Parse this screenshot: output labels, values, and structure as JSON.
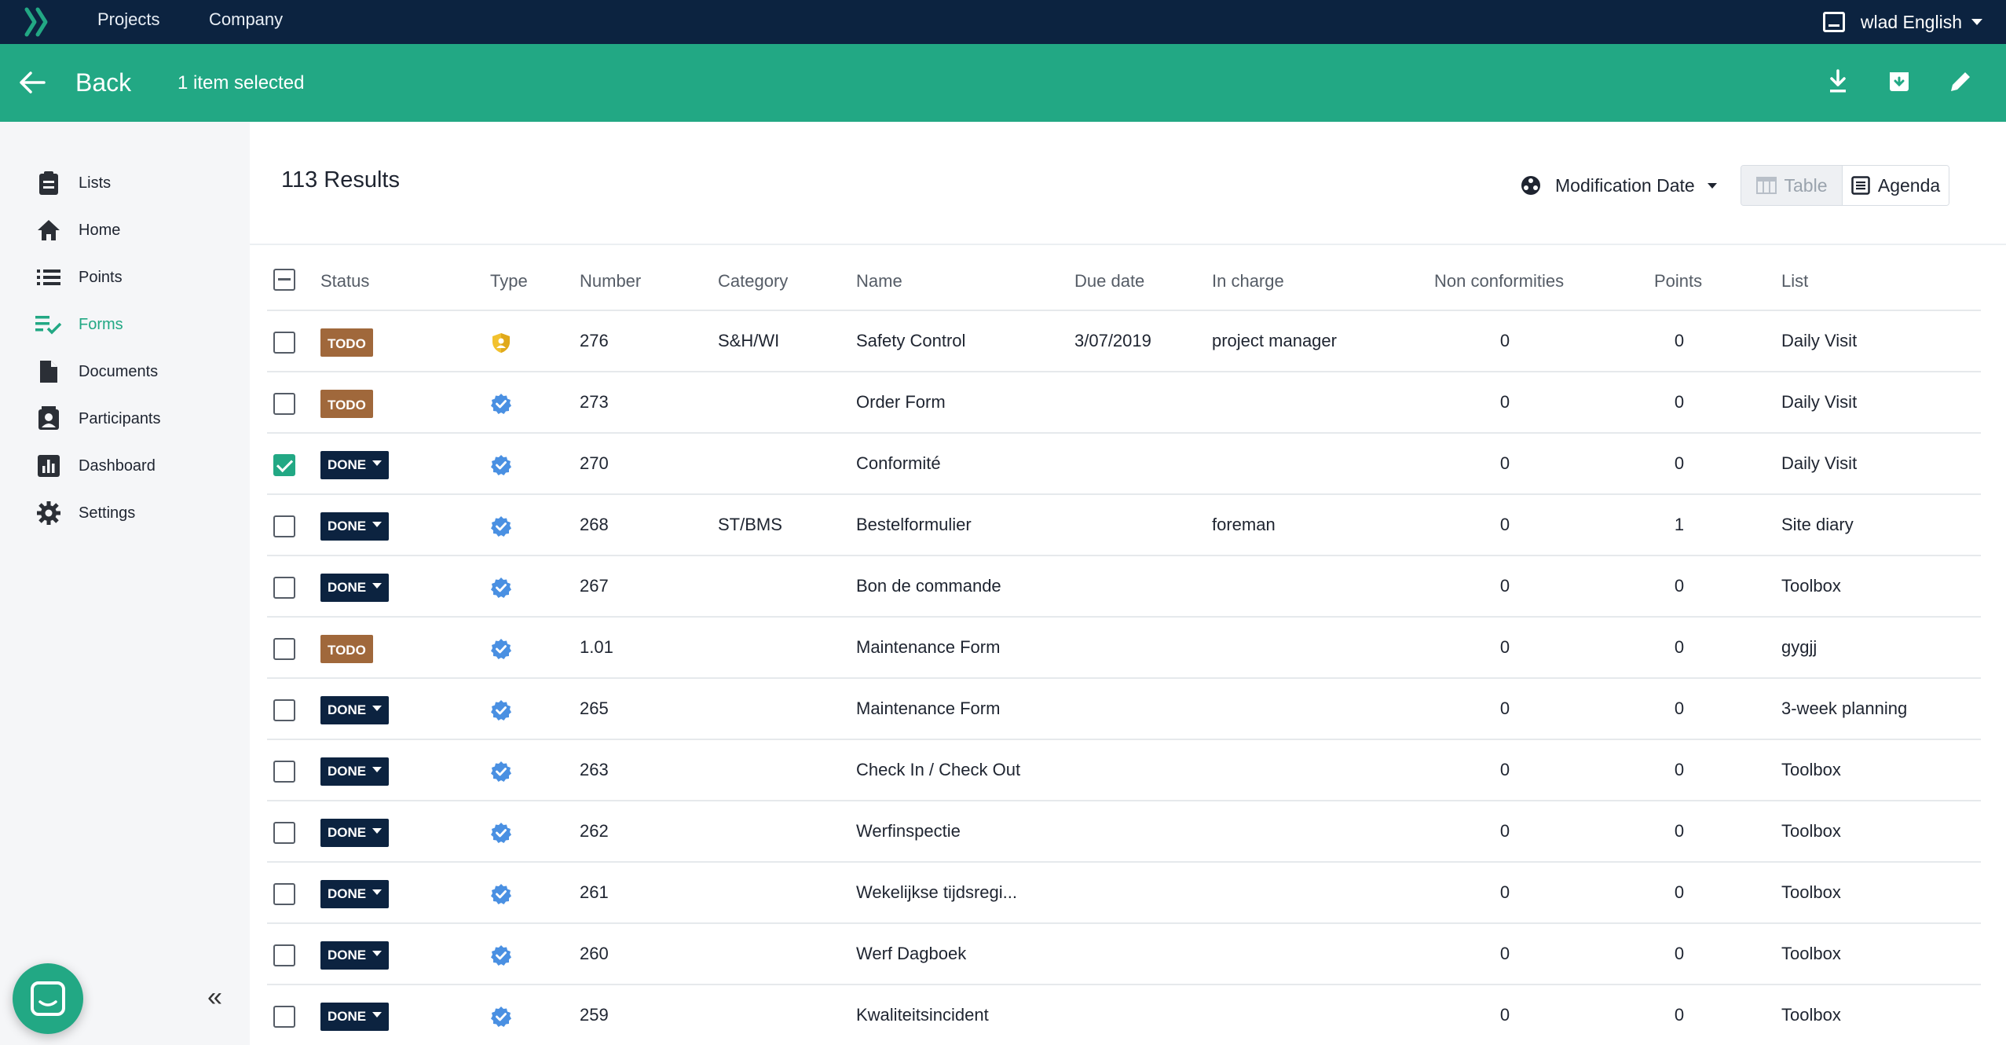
{
  "topnav": {
    "items": [
      "Projects",
      "Company"
    ],
    "user_label": "wlad English"
  },
  "actionbar": {
    "back_label": "Back",
    "selection_label": "1 item selected",
    "actions": [
      "download-icon",
      "archive-icon",
      "edit-icon"
    ]
  },
  "sidebar": {
    "items": [
      {
        "label": "Lists",
        "icon": "clipboard-icon"
      },
      {
        "label": "Home",
        "icon": "home-icon"
      },
      {
        "label": "Points",
        "icon": "list-icon"
      },
      {
        "label": "Forms",
        "icon": "checklist-icon",
        "active": true
      },
      {
        "label": "Documents",
        "icon": "document-icon"
      },
      {
        "label": "Participants",
        "icon": "participants-icon"
      },
      {
        "label": "Dashboard",
        "icon": "chart-icon"
      },
      {
        "label": "Settings",
        "icon": "gear-icon"
      }
    ],
    "collapse_label": "«"
  },
  "results": {
    "count_label": "113  Results",
    "sort_label": "Modification Date",
    "view_table": "Table",
    "view_agenda": "Agenda"
  },
  "table": {
    "columns": [
      "Status",
      "Type",
      "Number",
      "Category",
      "Name",
      "Due date",
      "In charge",
      "Non conformities",
      "Points",
      "List"
    ],
    "rows": [
      {
        "checked": false,
        "status": "TODO",
        "type": "shield",
        "number": "276",
        "category": "S&H/WI",
        "name": "Safety Control",
        "due": "3/07/2019",
        "in_charge": "project manager",
        "nc": "0",
        "points": "0",
        "list": "Daily Visit"
      },
      {
        "checked": false,
        "status": "TODO",
        "type": "verified",
        "number": "273",
        "category": "",
        "name": "Order Form",
        "due": "",
        "in_charge": "",
        "nc": "0",
        "points": "0",
        "list": "Daily Visit"
      },
      {
        "checked": true,
        "status": "DONE",
        "type": "verified",
        "number": "270",
        "category": "",
        "name": "Conformité",
        "due": "",
        "in_charge": "",
        "nc": "0",
        "points": "0",
        "list": "Daily Visit"
      },
      {
        "checked": false,
        "status": "DONE",
        "type": "verified",
        "number": "268",
        "category": "ST/BMS",
        "name": "Bestelformulier",
        "due": "",
        "in_charge": "foreman",
        "nc": "0",
        "points": "1",
        "list": "Site diary"
      },
      {
        "checked": false,
        "status": "DONE",
        "type": "verified",
        "number": "267",
        "category": "",
        "name": "Bon de commande",
        "due": "",
        "in_charge": "",
        "nc": "0",
        "points": "0",
        "list": "Toolbox"
      },
      {
        "checked": false,
        "status": "TODO",
        "type": "verified",
        "number": "1.01",
        "category": "",
        "name": "Maintenance Form",
        "due": "",
        "in_charge": "",
        "nc": "0",
        "points": "0",
        "list": "gygjj"
      },
      {
        "checked": false,
        "status": "DONE",
        "type": "verified",
        "number": "265",
        "category": "",
        "name": "Maintenance Form",
        "due": "",
        "in_charge": "",
        "nc": "0",
        "points": "0",
        "list": "3-week planning"
      },
      {
        "checked": false,
        "status": "DONE",
        "type": "verified",
        "number": "263",
        "category": "",
        "name": "Check In / Check Out",
        "due": "",
        "in_charge": "",
        "nc": "0",
        "points": "0",
        "list": "Toolbox"
      },
      {
        "checked": false,
        "status": "DONE",
        "type": "verified",
        "number": "262",
        "category": "",
        "name": "Werfinspectie",
        "due": "",
        "in_charge": "",
        "nc": "0",
        "points": "0",
        "list": "Toolbox"
      },
      {
        "checked": false,
        "status": "DONE",
        "type": "verified",
        "number": "261",
        "category": "",
        "name": "Wekelijkse tijdsregi...",
        "due": "",
        "in_charge": "",
        "nc": "0",
        "points": "0",
        "list": "Toolbox"
      },
      {
        "checked": false,
        "status": "DONE",
        "type": "verified",
        "number": "260",
        "category": "",
        "name": "Werf Dagboek",
        "due": "",
        "in_charge": "",
        "nc": "0",
        "points": "0",
        "list": "Toolbox"
      },
      {
        "checked": false,
        "status": "DONE",
        "type": "verified",
        "number": "259",
        "category": "",
        "name": "Kwaliteitsincident",
        "due": "",
        "in_charge": "",
        "nc": "0",
        "points": "0",
        "list": "Toolbox"
      }
    ]
  },
  "colors": {
    "topbar": "#0c2340",
    "accent": "#22a884",
    "todo": "#a0683b",
    "done": "#0c2340",
    "verified": "#4a90e2",
    "shield": "#f2c12e"
  }
}
